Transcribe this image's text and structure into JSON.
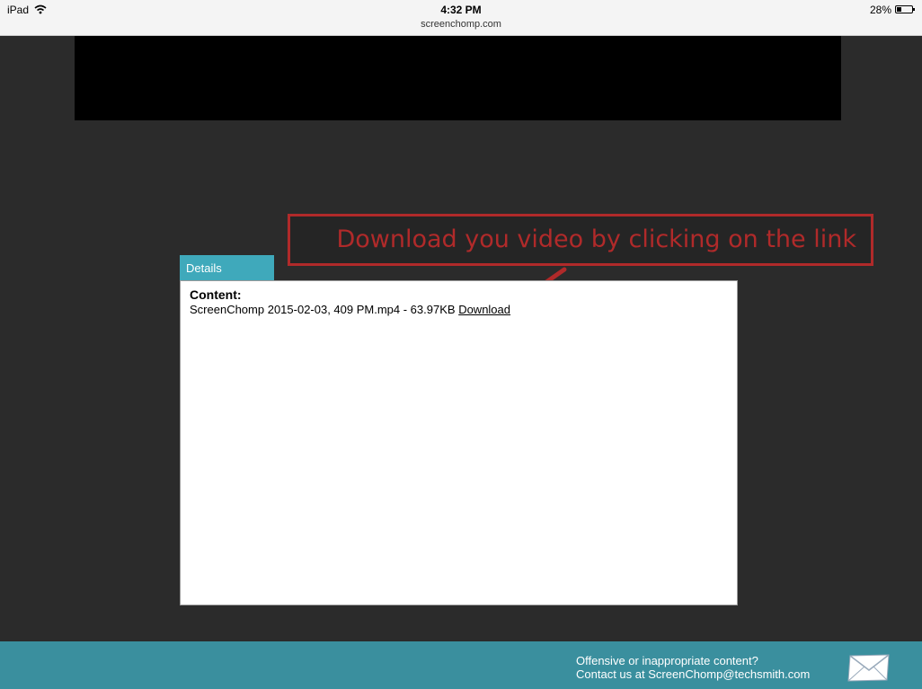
{
  "statusbar": {
    "device": "iPad",
    "time": "4:32 PM",
    "url": "screenchomp.com",
    "battery": "28%",
    "icons": [
      "wifi-icon",
      "battery-icon"
    ]
  },
  "annotation": {
    "text": "Download you video by clicking on the link",
    "color": "#b02a2a"
  },
  "details": {
    "tab_label": "Details",
    "content_label": "Content:",
    "file_text": "ScreenChomp 2015-02-03, 409 PM.mp4 - 63.97KB",
    "download_label": "Download"
  },
  "footer": {
    "line1": "Offensive or inappropriate content?",
    "line2": "Contact us at ScreenChomp@techsmith.com",
    "icon": "mail-icon"
  },
  "colors": {
    "accent": "#3fa9bb",
    "footer": "#3a8f9e",
    "background": "#2b2b2b"
  }
}
